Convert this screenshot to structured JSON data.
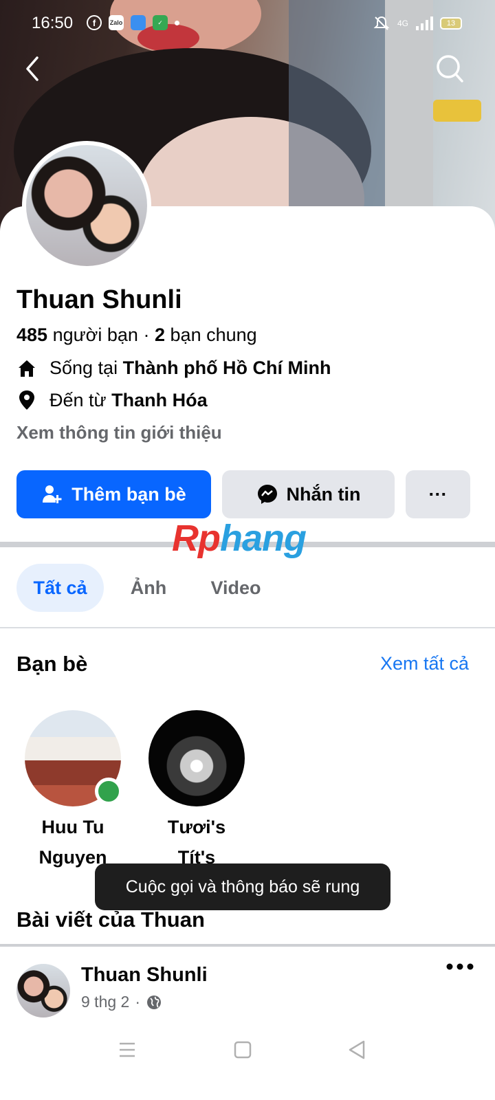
{
  "status_bar": {
    "time": "16:50",
    "app_icons": [
      "facebook-icon",
      "zalo-icon",
      "blue-app-icon",
      "green-app-icon"
    ],
    "zalo_label": "Zalo",
    "network": "4G",
    "battery": "13"
  },
  "header": {
    "back_icon": "chevron-left-icon",
    "search_icon": "search-icon"
  },
  "profile": {
    "name": "Thuan Shunli",
    "friend_count": "485",
    "friend_label": "người bạn",
    "separator": "·",
    "mutual_count": "2",
    "mutual_label": "bạn chung",
    "lives_prefix": "Sống tại",
    "lives_city": "Thành phố Hồ Chí Minh",
    "from_prefix": "Đến từ",
    "from_city": "Thanh Hóa",
    "about_link": "Xem thông tin giới thiệu"
  },
  "actions": {
    "add_friend": "Thêm bạn bè",
    "message": "Nhắn tin",
    "more": "···"
  },
  "watermark": {
    "part_a": "Rp",
    "part_b": "hang"
  },
  "tabs": [
    {
      "label": "Tất cả",
      "active": true
    },
    {
      "label": "Ảnh",
      "active": false
    },
    {
      "label": "Video",
      "active": false
    }
  ],
  "friends_section": {
    "title": "Bạn bè",
    "see_all": "Xem tất cả",
    "items": [
      {
        "line1": "Huu Tu",
        "line2": "Nguyen",
        "online": true
      },
      {
        "line1": "Tươi's",
        "line2": "Tít's",
        "online": false
      }
    ]
  },
  "toast": "Cuộc gọi và thông báo sẽ rung",
  "posts_section": {
    "title": "Bài viết của Thuan"
  },
  "post": {
    "author": "Thuan Shunli",
    "date": "9 thg 2",
    "separator": "·",
    "privacy_icon": "globe-icon"
  },
  "colors": {
    "primary": "#0866ff",
    "link": "#1877f2",
    "secondary_bg": "#e4e6eb",
    "online": "#31a24c"
  }
}
